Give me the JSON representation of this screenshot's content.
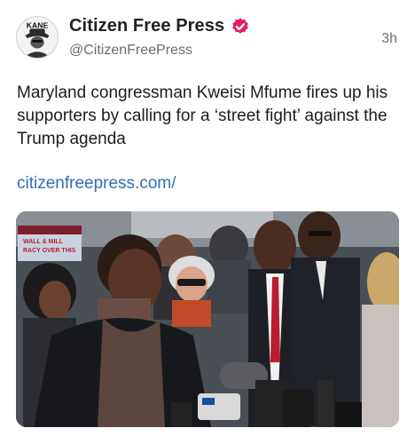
{
  "post": {
    "author": {
      "display_name": "Citizen Free Press",
      "handle": "@CitizenFreePress",
      "avatar_text": "KANE",
      "verified_icon": "verified-badge-icon",
      "verified_color": "#e0245e"
    },
    "timestamp": "3h",
    "text": "Maryland congressman Kweisi Mfume fires up his supporters by calling for a ‘street fight’ against the Trump agenda",
    "link": "citizenfreepress.com/",
    "link_color": "#2f6fb7",
    "media": {
      "kind": "photo",
      "sign_text_1": "WALL & MILL",
      "sign_text_2": "RACY OVER THIS"
    }
  }
}
